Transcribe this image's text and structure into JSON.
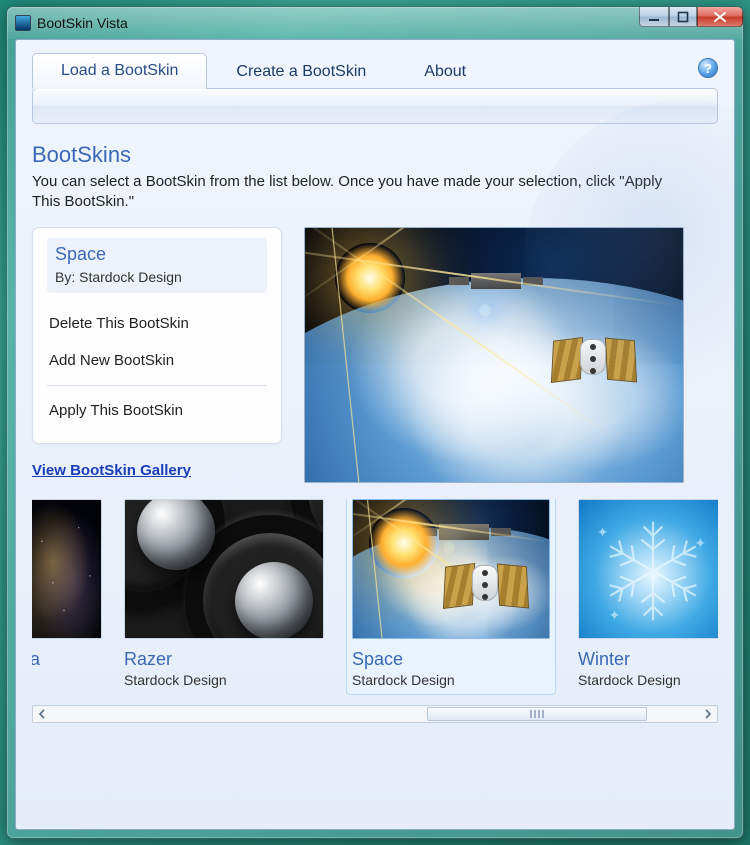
{
  "window": {
    "title": "BootSkin Vista"
  },
  "tabs": {
    "load": {
      "label": "Load a BootSkin"
    },
    "create": {
      "label": "Create a BootSkin"
    },
    "about": {
      "label": "About"
    }
  },
  "help_glyph": "?",
  "section": {
    "heading": "BootSkins",
    "description": "You can select a BootSkin from the list below.  Once you have made your selection, click \"Apply This BootSkin.\""
  },
  "side_panel": {
    "skin_title": "Space",
    "author_prefix": "By: ",
    "author": "Stardock Design",
    "delete_label": "Delete This BootSkin",
    "add_label": "Add New BootSkin",
    "apply_label": "Apply This BootSkin"
  },
  "links": {
    "gallery": "View BootSkin Gallery"
  },
  "thumbnails": [
    {
      "title": "la",
      "author": ""
    },
    {
      "title": "Razer",
      "author": "Stardock Design"
    },
    {
      "title": "Space",
      "author": "Stardock Design",
      "selected": true
    },
    {
      "title": "Winter",
      "author": "Stardock Design"
    }
  ],
  "selected_skin": "Space"
}
